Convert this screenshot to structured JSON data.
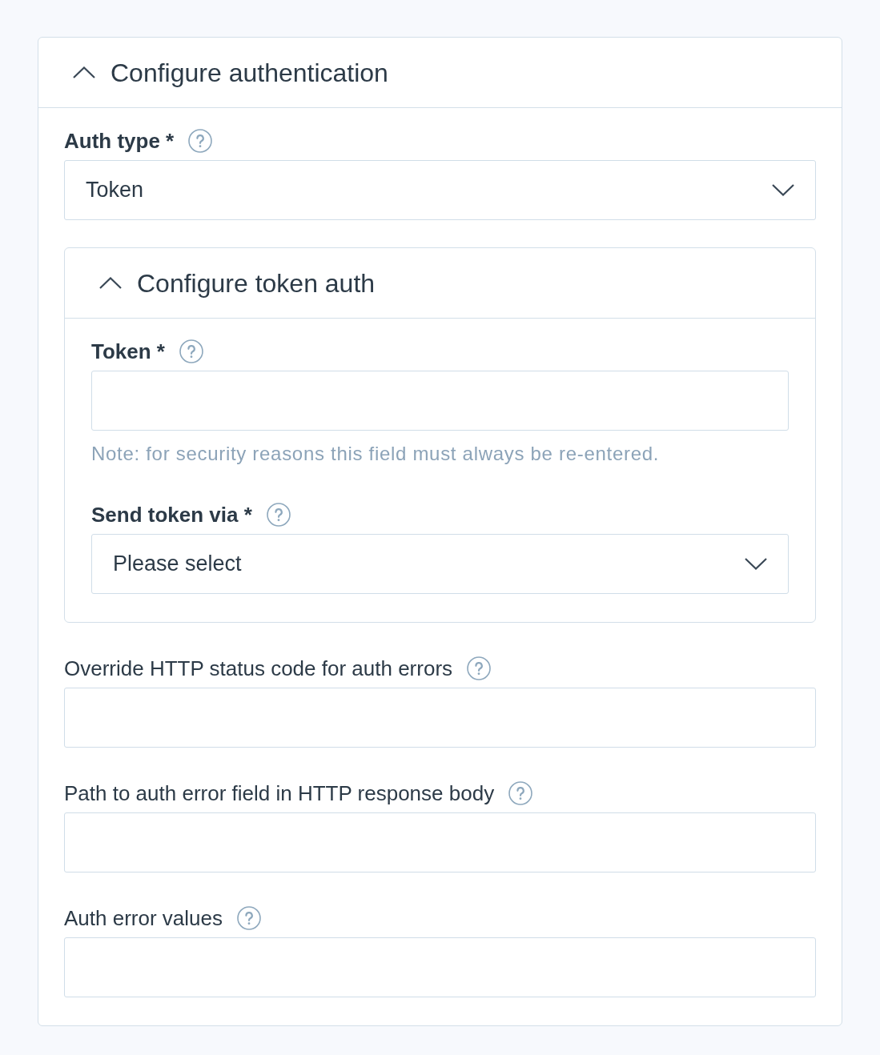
{
  "section": {
    "title": "Configure authentication",
    "expanded": true,
    "fields": [
      {
        "kind": "select",
        "label": "Auth type",
        "required": true,
        "required_mark": "*",
        "value": "Token"
      },
      {
        "kind": "group",
        "title": "Configure token auth",
        "expanded": true,
        "fields": [
          {
            "kind": "text",
            "label": "Token",
            "required": true,
            "required_mark": "*",
            "note": "Note: for security reasons this field must always be re-entered."
          },
          {
            "kind": "select",
            "label": "Send token via",
            "required": true,
            "required_mark": "*",
            "value": "Please select"
          }
        ]
      },
      {
        "kind": "text",
        "label": "Override HTTP status code for auth errors",
        "required": false
      },
      {
        "kind": "text",
        "label": "Path to auth error field in HTTP response body",
        "required": false
      },
      {
        "kind": "text",
        "label": "Auth error values",
        "required": false
      }
    ]
  }
}
